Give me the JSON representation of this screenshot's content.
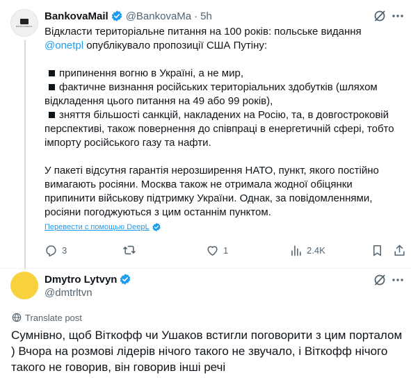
{
  "post": {
    "author_name": "BankovaMail",
    "author_handle": "@BankovaMa",
    "separator": "·",
    "time": "5h",
    "avatar_text": "BANKOVAMAIL",
    "text_line1_a": "Відкласти територіальне питання на 100 років: польське видання ",
    "text_line1_mention": "@onetpl",
    "text_line1_b": " опублікувало пропозиції США Путіну:",
    "bullets": [
      "припинення вогню в Україні, а не мир,",
      "фактичне визнання російських територіальних здобутків (шляхом відкладення цього питання на 49 або 99 років),",
      "зняття більшості санкцій, накладених на Росію, та, в довгостроковій перспективі, також повернення до співпраці в енергетичній сфері, тобто імпорту російського газу та нафти."
    ],
    "paragraph2": "У пакеті відсутня гарантія нерозширення НАТО, пункт, якого постійно вимагають росіяни. Москва також не отримала жодної обіцянки припинити військову підтримку України. Однак, за повідомленнями, росіяни погоджуються з цим останнім пунктом.",
    "translate_label": "Перевести с помощью DeepL",
    "actions": {
      "replies": "3",
      "reposts": "",
      "likes": "1",
      "views": "2.4K"
    }
  },
  "reply": {
    "author_name": "Dmytro Lytvyn",
    "author_handle": "@dmtrltvn",
    "translate_label": "Translate post",
    "text": "Сумнівно, щоб Віткофф чи Ушаков встигли поговорити з цим порталом ) Вчора на розмові лідерів нічого такого не звучало, і Віткофф нічого такого не говорив, він говорив інші речі"
  },
  "colors": {
    "accent": "#1d9bf0",
    "secondary_text": "#536471",
    "reply_avatar": "#f8d13e"
  }
}
